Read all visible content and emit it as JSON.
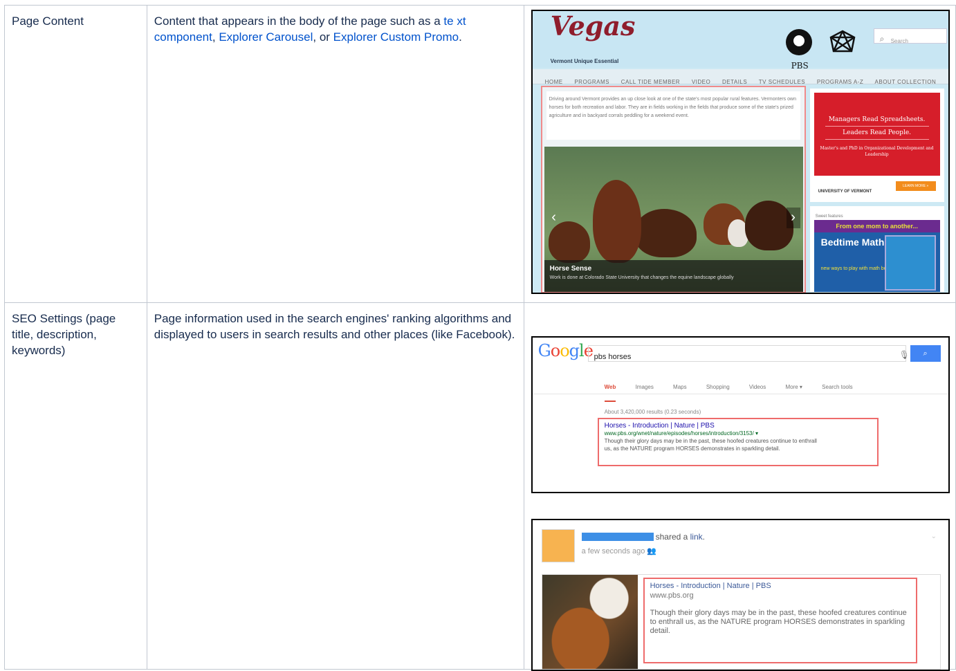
{
  "rows": [
    {
      "label": "Page Content",
      "desc_before": "Content that appears in the body of the page such as a ",
      "link1": "te xt component",
      "sep1": ", ",
      "link2": "Explorer Carousel",
      "sep2": ", or ",
      "link3": "Explorer Custom Promo",
      "desc_after": "."
    },
    {
      "label": "SEO Settings (page title, description, keywords)",
      "description": "Page information used in the search engines' ranking algorithms and displayed to users in search results and other places (like Facebook)."
    }
  ],
  "site": {
    "logo": "Vegas",
    "tagline": "Vermont Unique Essential",
    "pbs_label": "PBS",
    "search_placeholder": "Search",
    "nav": [
      "HOME",
      "PROGRAMS",
      "CALL TIDE MEMBER",
      "VIDEO",
      "DETAILS",
      "TV SCHEDULES",
      "PROGRAMS A-Z",
      "ABOUT COLLECTION"
    ],
    "intro": "Driving around Vermont provides an up close look at one of the state's most popular rural features. Vermonters own horses for both recreation and labor. They are in fields working in the fields that produce some of the state's prized agriculture and in backyard corrals peddling for a weekend event.",
    "slide_title": "Horse Sense",
    "slide_caption": "Work is done at Colorado State University that changes the equine landscape globally",
    "ad1": {
      "line1": "Managers Read Spreadsheets.",
      "line2": "Leaders Read People.",
      "line3": "Master's and PhD in Organizational Development and Leadership",
      "univ": "UNIVERSITY OF VERMONT",
      "button": "LEARN MORE »"
    },
    "ad2": {
      "label": "Sweet features",
      "band": "From one mom to another...",
      "title": "Bedtime Math",
      "sub": "new ways to play with math before bed"
    }
  },
  "google": {
    "query": "pbs horses",
    "search_button_icon": "search-icon",
    "tabs": [
      "Web",
      "Images",
      "Maps",
      "Shopping",
      "Videos",
      "More ▾",
      "Search tools"
    ],
    "results_count": "About 3,420,000 results (0.23 seconds)",
    "result_title": "Horses - Introduction | Nature | PBS",
    "result_url": "www.pbs.org/wnet/nature/episodes/horses/introduction/3153/ ▾",
    "result_snippet_1": "Though their glory days may be in the past, these hoofed creatures continue to enthrall",
    "result_snippet_2": "us, as the NATURE program HORSES demonstrates in sparkling detail."
  },
  "facebook": {
    "action_prefix": "shared a ",
    "action_link": "link",
    "action_suffix": ".",
    "time": "a few seconds ago",
    "link_title": "Horses - Introduction | Nature | PBS",
    "link_url": "www.pbs.org",
    "link_desc": "Though their glory days may be in the past, these hoofed creatures continue to enthrall us, as the NATURE program HORSES demonstrates in sparkling detail."
  },
  "colors": {
    "link": "#0052cc",
    "highlight_border": "#ee6b6b",
    "table_border": "#c1c7d0"
  }
}
